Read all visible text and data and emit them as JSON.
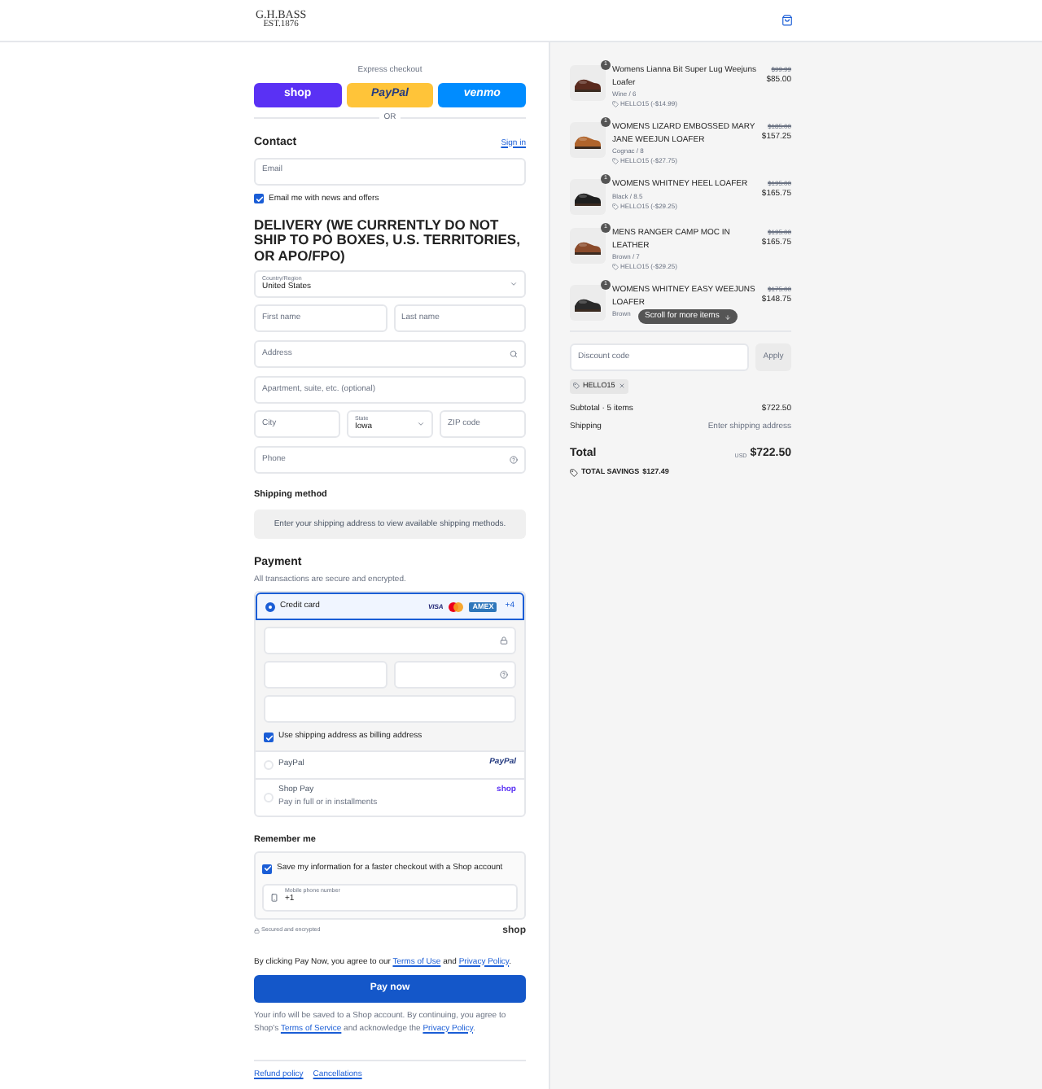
{
  "header": {
    "logo_line1": "G.H.BASS",
    "logo_line2": "EST.1876"
  },
  "express": {
    "label": "Express checkout",
    "buttons": [
      {
        "kind": "shop",
        "label": "shop"
      },
      {
        "kind": "paypal",
        "label": "PayPal"
      },
      {
        "kind": "venmo",
        "label": "venmo"
      }
    ],
    "divider": "OR"
  },
  "contact": {
    "title": "Contact",
    "sign_in": "Sign in",
    "email_placeholder": "Email",
    "newsletter": {
      "label": "Email me with news and offers",
      "checked": true
    }
  },
  "delivery": {
    "title": "DELIVERY (WE CURRENTLY DO NOT SHIP TO PO BOXES, U.S. TERRITORIES, OR APO/FPO)",
    "country": {
      "label": "Country/Region",
      "value": "United States"
    },
    "first_name": "First name",
    "last_name": "Last name",
    "address": "Address",
    "apartment": "Apartment, suite, etc. (optional)",
    "city": "City",
    "state": {
      "label": "State",
      "value": "Iowa"
    },
    "zip": "ZIP code",
    "phone": "Phone"
  },
  "shipping_method": {
    "title": "Shipping method",
    "message": "Enter your shipping address to view available shipping methods."
  },
  "payment": {
    "title": "Payment",
    "subtitle": "All transactions are secure and encrypted.",
    "methods": [
      {
        "kind": "card",
        "label": "Credit card",
        "selected": true,
        "brands": [
          {
            "kind": "visa",
            "label": "VISA"
          },
          {
            "kind": "mastercard"
          },
          {
            "kind": "amex",
            "label": "AMEX"
          }
        ],
        "more": "+4"
      },
      {
        "kind": "paypal",
        "label": "PayPal",
        "selected": false,
        "logo": "PayPal"
      },
      {
        "kind": "shoppay",
        "label": "Shop Pay",
        "selected": false,
        "sub": "Pay in full or in installments",
        "logo": "shop"
      }
    ],
    "billing": {
      "label": "Use shipping address as billing address",
      "checked": true
    }
  },
  "remember": {
    "title": "Remember me",
    "save": {
      "label": "Save my information for a faster checkout with a Shop account",
      "checked": true
    },
    "phone": {
      "label": "Mobile phone number",
      "value": "+1"
    },
    "secured": "Secured and encrypted",
    "shop_logo": "shop"
  },
  "legal": [
    {
      "kind": "text",
      "text": "By clicking Pay Now, you agree to our "
    },
    {
      "kind": "link",
      "text": "Terms of Use"
    },
    {
      "kind": "text",
      "text": " and "
    },
    {
      "kind": "link",
      "text": "Privacy Policy"
    },
    {
      "kind": "text",
      "text": "."
    }
  ],
  "pay_button": "Pay now",
  "shop_notice": [
    {
      "kind": "text",
      "text": "Your info will be saved to a Shop account. By continuing, you agree to Shop's "
    },
    {
      "kind": "link",
      "text": "Terms of Service"
    },
    {
      "kind": "text",
      "text": " and acknowledge the "
    },
    {
      "kind": "link",
      "text": "Privacy Policy"
    },
    {
      "kind": "text",
      "text": "."
    }
  ],
  "footer_links": [
    "Refund policy",
    "Cancellations"
  ],
  "summary": {
    "items": [
      {
        "title": "Womens Lianna Bit Super Lug Weejuns Loafer",
        "variant": "Wine / 6",
        "discount": "HELLO15 (-$14.99)",
        "original_price": "$99.99",
        "price": "$85.00",
        "quantity": "1"
      },
      {
        "title": "WOMENS LIZARD EMBOSSED MARY JANE WEEJUN LOAFER",
        "variant": "Cognac / 8",
        "discount": "HELLO15 (-$27.75)",
        "original_price": "$185.00",
        "price": "$157.25",
        "quantity": "1"
      },
      {
        "title": "WOMENS WHITNEY HEEL LOAFER",
        "variant": "Black / 8.5",
        "discount": "HELLO15 (-$29.25)",
        "original_price": "$195.00",
        "price": "$165.75",
        "quantity": "1"
      },
      {
        "title": "MENS RANGER CAMP MOC IN LEATHER",
        "variant": "Brown / 7",
        "discount": "HELLO15 (-$29.25)",
        "original_price": "$195.00",
        "price": "$165.75",
        "quantity": "1"
      },
      {
        "title": "WOMENS WHITNEY EASY WEEJUNS LOAFER",
        "variant": "Brown",
        "original_price": "$175.00",
        "price": "$148.75",
        "quantity": "1"
      }
    ],
    "scroll_hint": "Scroll for more items",
    "discount": {
      "placeholder": "Discount code",
      "button": "Apply",
      "tag": "HELLO15"
    },
    "subtotal": {
      "label": "Subtotal · 5 items",
      "value": "$722.50"
    },
    "shipping": {
      "label": "Shipping",
      "value": "Enter shipping address"
    },
    "total": {
      "label": "Total",
      "currency": "USD",
      "value": "$722.50"
    },
    "savings": {
      "label": "TOTAL SAVINGS",
      "value": "$127.49"
    }
  }
}
